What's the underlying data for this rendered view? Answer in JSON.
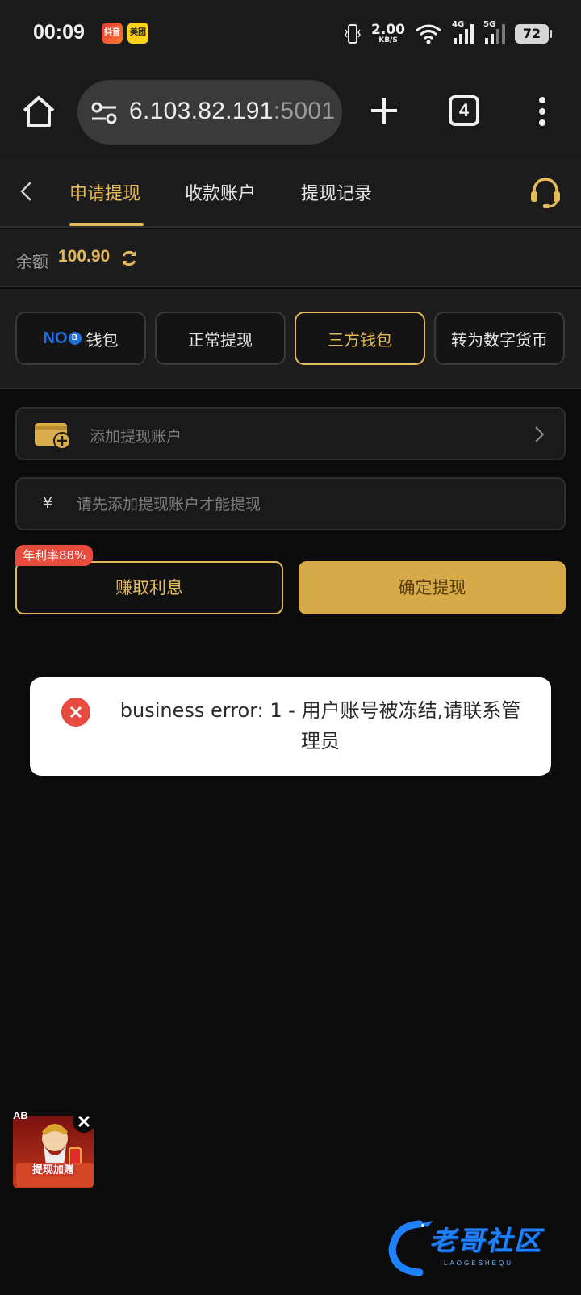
{
  "status_bar": {
    "time": "00:09",
    "app_icons": [
      {
        "name": "app-icon-red",
        "text": "抖音"
      },
      {
        "name": "meituan-icon",
        "text": "美团"
      }
    ],
    "net_speed_value": "2.00",
    "net_speed_unit": "KB/S",
    "signal_1_label": "4G",
    "signal_2_label": "5G",
    "battery": "72"
  },
  "browser": {
    "url_main": "6.103.82.191",
    "url_port": ":5001",
    "tab_count": "4"
  },
  "nav": {
    "tabs": [
      "申请提现",
      "收款账户",
      "提现记录"
    ],
    "active_tab_index": 0
  },
  "balance": {
    "label": "余额",
    "value": "100.90"
  },
  "methods": {
    "items": [
      "钱包",
      "正常提现",
      "三方钱包",
      "转为数字货币"
    ],
    "wallet_brand": "NO",
    "active_index": 2
  },
  "form": {
    "add_account_label": "添加提现账户",
    "currency_symbol": "¥",
    "amount_placeholder": "请先添加提现账户才能提现",
    "earn_button": "赚取利息",
    "rate_badge": "年利率88%",
    "confirm_button": "确定提现"
  },
  "toast": {
    "message": "business error: 1 - 用户账号被冻结,请联系管理员"
  },
  "promo": {
    "label": "提现加赠",
    "corner_text": "AB"
  },
  "watermark": {
    "text": "老哥社区",
    "sub": "LAOGESHEQU"
  },
  "colors": {
    "accent_gold": "#e4b95a",
    "error_red": "#e64b3f",
    "background": "#0b0b0b"
  }
}
